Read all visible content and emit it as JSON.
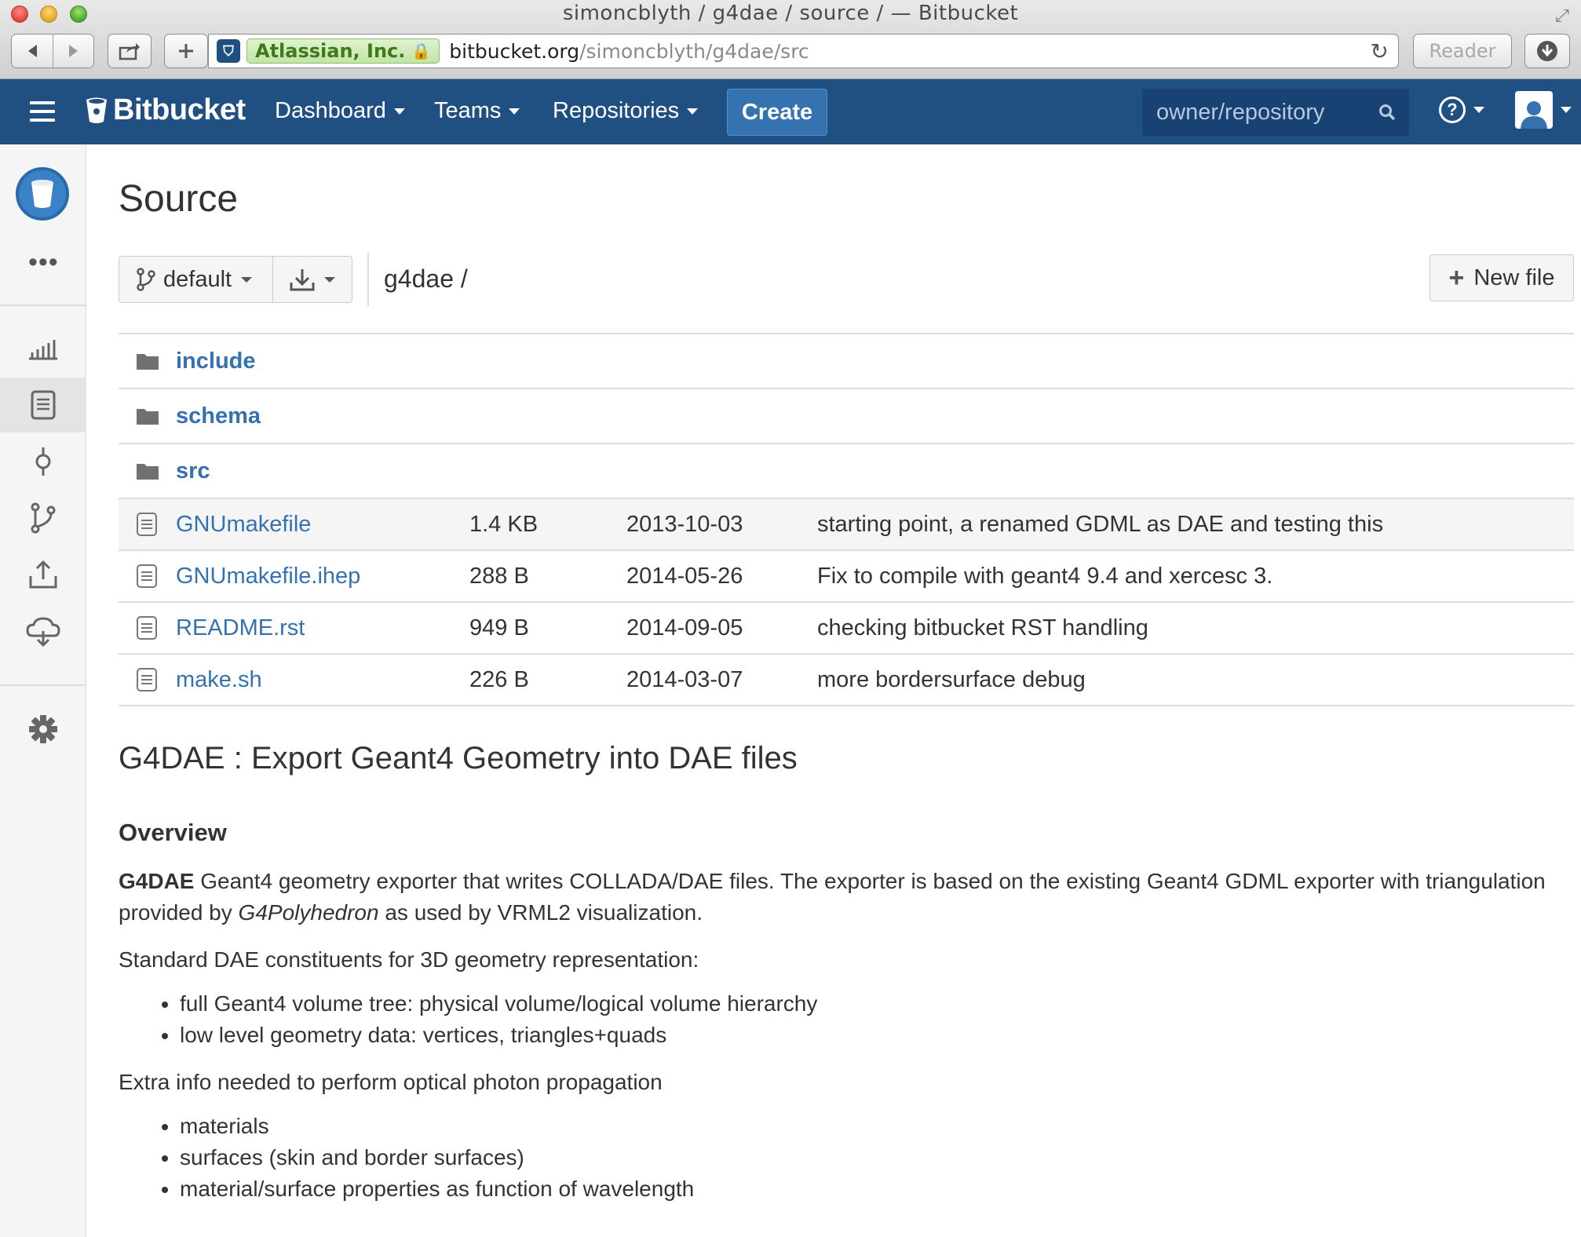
{
  "window": {
    "title": "simoncblyth / g4dae / source / — Bitbucket"
  },
  "browser": {
    "ev_label": "Atlassian, Inc.",
    "url_host": "bitbucket.org",
    "url_path": "/simoncblyth/g4dae/src",
    "reader_label": "Reader"
  },
  "header": {
    "logo_text": "Bitbucket",
    "nav": {
      "dashboard": "Dashboard",
      "teams": "Teams",
      "repositories": "Repositories"
    },
    "create_label": "Create",
    "search_placeholder": "owner/repository",
    "help_label": "?",
    "brand_color": "#205081"
  },
  "sidebar": {
    "more_label": "•••",
    "items": [
      "overview-icon",
      "source-icon",
      "commits-icon",
      "branches-icon",
      "pull-requests-icon",
      "downloads-icon",
      "settings-icon"
    ],
    "active": "source-icon"
  },
  "main": {
    "title": "Source",
    "branch": "default",
    "breadcrumb": "g4dae /",
    "new_file_label": "New file"
  },
  "files": {
    "directories": [
      {
        "name": "include"
      },
      {
        "name": "schema"
      },
      {
        "name": "src"
      }
    ],
    "files": [
      {
        "name": "GNUmakefile",
        "size": "1.4 KB",
        "date": "2013-10-03",
        "message": "starting point, a renamed GDML as DAE and testing this"
      },
      {
        "name": "GNUmakefile.ihep",
        "size": "288 B",
        "date": "2014-05-26",
        "message": "Fix to compile with geant4 9.4 and xercesc 3."
      },
      {
        "name": "README.rst",
        "size": "949 B",
        "date": "2014-09-05",
        "message": "checking bitbucket RST handling"
      },
      {
        "name": "make.sh",
        "size": "226 B",
        "date": "2014-03-07",
        "message": "more bordersurface debug"
      }
    ]
  },
  "readme": {
    "title": "G4DAE : Export Geant4 Geometry into DAE files",
    "overview_heading": "Overview",
    "intro_bold": "G4DAE",
    "intro_text1": " Geant4 geometry exporter that writes COLLADA/DAE files. The exporter is based on the existing Geant4 GDML exporter with triangulation provided by ",
    "intro_italic": "G4Polyhedron",
    "intro_text2": " as used by VRML2 visualization.",
    "std_heading": "Standard DAE constituents for 3D geometry representation:",
    "std_items": [
      "full Geant4 volume tree: physical volume/logical volume hierarchy",
      "low level geometry data: vertices, triangles+quads"
    ],
    "extra_heading": "Extra info needed to perform optical photon propagation",
    "extra_items": [
      "materials",
      "surfaces (skin and border surfaces)",
      "material/surface properties as function of wavelength"
    ]
  }
}
